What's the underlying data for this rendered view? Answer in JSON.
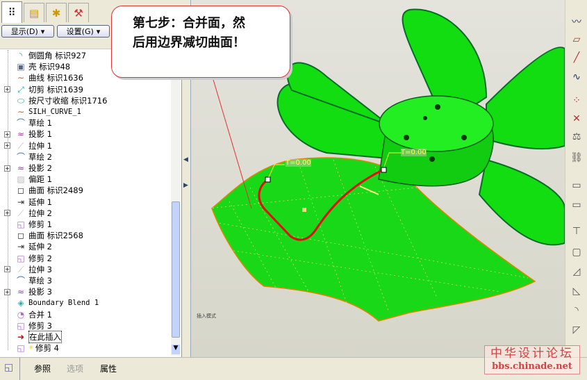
{
  "left_tabs": [
    "model-tree-tab",
    "layer-tab",
    "favorites-tab",
    "tools-tab"
  ],
  "toolbar": {
    "show_label": "显示(D)",
    "settings_label": "设置(G)"
  },
  "tree": [
    {
      "label": "倒圆角 标识927",
      "icon": "round-icon",
      "expand": false
    },
    {
      "label": "壳 标识948",
      "icon": "shell-icon",
      "expand": false
    },
    {
      "label": "曲线 标识1636",
      "icon": "curve-icon",
      "expand": false
    },
    {
      "label": "切剪 标识1639",
      "icon": "cut-icon",
      "expand": true
    },
    {
      "label": "按尺寸收缩 标识1716",
      "icon": "shrink-icon",
      "expand": false
    },
    {
      "label": "SILH_CURVE_1",
      "icon": "curve-icon",
      "expand": false,
      "mono": true
    },
    {
      "label": "草绘 1",
      "icon": "sketch-icon",
      "expand": false
    },
    {
      "label": "投影 1",
      "icon": "projection-icon",
      "expand": true
    },
    {
      "label": "拉伸 1",
      "icon": "extrude-icon",
      "expand": true
    },
    {
      "label": "草绘 2",
      "icon": "sketch-icon",
      "expand": false
    },
    {
      "label": "投影 2",
      "icon": "projection-icon",
      "expand": true
    },
    {
      "label": "偏距 1",
      "icon": "offset-icon",
      "expand": false
    },
    {
      "label": "曲面 标识2489",
      "icon": "surface-icon",
      "expand": false
    },
    {
      "label": "延伸 1",
      "icon": "extend-icon",
      "expand": false
    },
    {
      "label": "拉伸 2",
      "icon": "extrude-icon",
      "expand": true
    },
    {
      "label": "修剪 1",
      "icon": "trim-icon",
      "expand": false
    },
    {
      "label": "曲面 标识2568",
      "icon": "surface-icon",
      "expand": false
    },
    {
      "label": "延伸 2",
      "icon": "extend-icon",
      "expand": false
    },
    {
      "label": "修剪 2",
      "icon": "trim-icon",
      "expand": false
    },
    {
      "label": "拉伸 3",
      "icon": "extrude-icon",
      "expand": true
    },
    {
      "label": "草绘 3",
      "icon": "sketch-icon",
      "expand": false
    },
    {
      "label": "投影 3",
      "icon": "projection-icon",
      "expand": true
    },
    {
      "label": "Boundary Blend 1",
      "icon": "boundary-blend-icon",
      "expand": false,
      "mono": true
    },
    {
      "label": "合并 1",
      "icon": "merge-icon",
      "expand": false
    },
    {
      "label": "修剪 3",
      "icon": "trim-icon",
      "expand": false
    },
    {
      "label": "在此插入",
      "icon": "insert-here-arrow-icon",
      "expand": false
    },
    {
      "label": "修剪 4",
      "icon": "trim-icon",
      "expand": false,
      "new": true
    }
  ],
  "callout": {
    "line1": "第七步：合并面，然",
    "line2": "后用边界减切曲面！"
  },
  "viewport": {
    "label_t1": "T=0.00",
    "label_t2": "T=0.00",
    "mode_text": "插入模式"
  },
  "bottom_tabs": {
    "ref": "参照",
    "options": "选项",
    "props": "属性"
  },
  "watermark": {
    "line1": "中华设计论坛",
    "line2": "bbs.chinade.net"
  },
  "colors": {
    "model": "#11dd11",
    "callout_border": "#dd3333",
    "trim_curve": "#dd1111"
  }
}
